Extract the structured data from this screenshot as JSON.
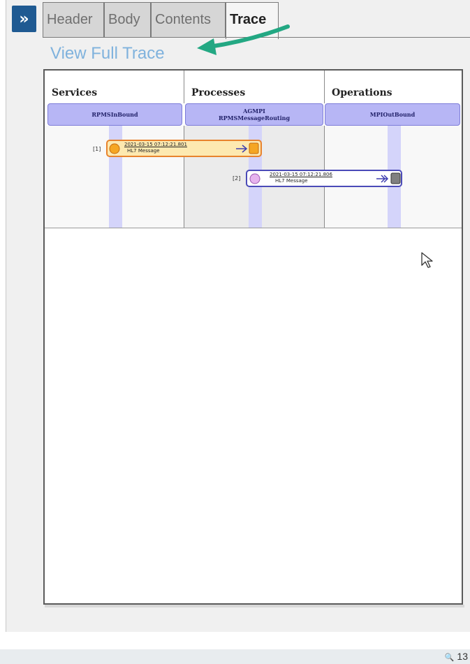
{
  "sidebar": {
    "expand_glyph": "»"
  },
  "tabs": [
    {
      "label": "Header",
      "active": false
    },
    {
      "label": "Body",
      "active": false
    },
    {
      "label": "Contents",
      "active": false
    },
    {
      "label": "Trace",
      "active": true
    }
  ],
  "link": {
    "view_full_trace": "View Full Trace"
  },
  "trace": {
    "columns": [
      "Services",
      "Processes",
      "Operations"
    ],
    "hosts": [
      {
        "line1": "",
        "line2": "RPMSInBound"
      },
      {
        "line1": "AGMPI",
        "line2": "RPMSMessageRouting"
      },
      {
        "line1": "",
        "line2": "MPIOutBound"
      }
    ],
    "messages": [
      {
        "index": "[1]",
        "timestamp": "2021-03-15 07:12:21.801",
        "type": "HL7 Message"
      },
      {
        "index": "[2]",
        "timestamp": "2021-03-15 07:12:21.806",
        "type": "HL7 Message"
      }
    ]
  },
  "status_bar": {
    "zoom": "13"
  },
  "colors": {
    "link": "#7fb2dd",
    "annotation_arrow": "#23a883",
    "host_fill": "#b7b6f5",
    "message1_border": "#e8832d",
    "message2_border": "#4b4bb8"
  }
}
